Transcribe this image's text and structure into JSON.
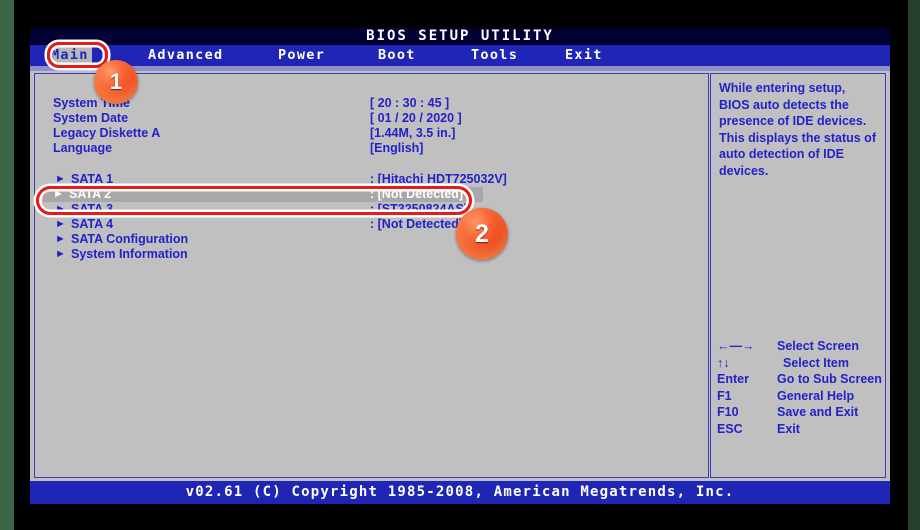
{
  "window": {
    "title": "BIOS SETUP UTILITY",
    "footer": "v02.61 (C) Copyright 1985-2008, American Megatrends, Inc."
  },
  "menu": {
    "items": [
      {
        "label": "Main",
        "selected": true
      },
      {
        "label": "Advanced",
        "selected": false
      },
      {
        "label": "Power",
        "selected": false
      },
      {
        "label": "Boot",
        "selected": false
      },
      {
        "label": "Tools",
        "selected": false
      },
      {
        "label": "Exit",
        "selected": false
      }
    ]
  },
  "main_panel": {
    "settings": [
      {
        "label": "System Time",
        "value": "[ 20 : 30 : 45 ]"
      },
      {
        "label": "System Date",
        "value": "[ 01 / 20 / 2020 ]"
      },
      {
        "label": "Legacy Diskette A",
        "value": "[1.44M, 3.5 in.]"
      },
      {
        "label": "Language",
        "value": "[English]"
      }
    ],
    "devices": [
      {
        "arrow": "►",
        "label": "SATA 1",
        "value": ": [Hitachi HDT725032V]",
        "highlighted": false
      },
      {
        "arrow": "►",
        "label": "SATA 2",
        "value": ": [Not Detected]",
        "highlighted": true
      },
      {
        "arrow": "►",
        "label": "SATA 3",
        "value": ": [ST3250824AS]",
        "highlighted": false
      },
      {
        "arrow": "►",
        "label": "SATA 4",
        "value": ": [Not Detected]",
        "highlighted": false
      }
    ],
    "submenus": [
      {
        "arrow": "►",
        "label": "SATA Configuration"
      },
      {
        "arrow": "►",
        "label": "System Information"
      }
    ]
  },
  "help_panel": {
    "text": "While entering setup, BIOS auto detects the presence of IDE devices. This displays the status of auto detection of IDE devices.",
    "keys": [
      {
        "key": "←—→",
        "desc": "Select Screen"
      },
      {
        "key": "↑↓",
        "desc": "Select Item"
      },
      {
        "key": "Enter",
        "desc": "Go to Sub Screen"
      },
      {
        "key": "F1",
        "desc": "General Help"
      },
      {
        "key": "F10",
        "desc": "Save and Exit"
      },
      {
        "key": "ESC",
        "desc": "Exit"
      }
    ]
  },
  "annotations": {
    "badges": [
      {
        "number": "1"
      },
      {
        "number": "2"
      }
    ]
  },
  "colors": {
    "screen_bg": "#c0c0c0",
    "menu_bar": "#1f26b5",
    "title_bar": "#000033",
    "text_blue": "#2222c8",
    "annotation_red": "#e81c16",
    "badge_orange": "#ea3d12"
  }
}
